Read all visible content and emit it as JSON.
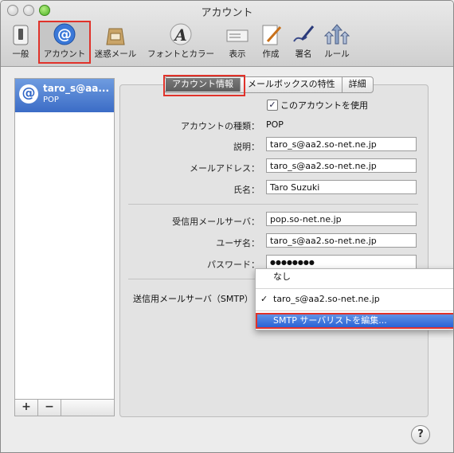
{
  "window": {
    "title": "アカウント"
  },
  "toolbar": {
    "items": [
      {
        "label": "一般",
        "icon": "switch-icon"
      },
      {
        "label": "アカウント",
        "icon": "at-sign-icon",
        "selected": true
      },
      {
        "label": "迷惑メール",
        "icon": "junk-mail-bag-icon"
      },
      {
        "label": "フォントとカラー",
        "icon": "font-color-icon"
      },
      {
        "label": "表示",
        "icon": "view-icon"
      },
      {
        "label": "作成",
        "icon": "compose-pen-icon"
      },
      {
        "label": "署名",
        "icon": "signature-pen-icon"
      },
      {
        "label": "ルール",
        "icon": "rules-arrows-icon"
      }
    ]
  },
  "sidebar": {
    "accounts": [
      {
        "name": "taro_s@aa...",
        "type": "POP"
      }
    ],
    "add_label": "+",
    "remove_label": "−"
  },
  "tabs": [
    {
      "label": "アカウント情報",
      "selected": true
    },
    {
      "label": "メールボックスの特性"
    },
    {
      "label": "詳細"
    }
  ],
  "form": {
    "enable_label": "このアカウントを使用",
    "enable_checked": true,
    "account_type_label": "アカウントの種類：",
    "account_type_value": "POP",
    "description_label": "説明：",
    "description_value": "taro_s@aa2.so-net.ne.jp",
    "email_label": "メールアドレス：",
    "email_value": "taro_s@aa2.so-net.ne.jp",
    "name_label": "氏名：",
    "name_value": "Taro Suzuki",
    "incoming_label": "受信用メールサーバ：",
    "incoming_value": "pop.so-net.ne.jp",
    "username_label": "ユーザ名：",
    "username_value": "taro_s@aa2.so-net.ne.jp",
    "password_label": "パスワード：",
    "password_value": "●●●●●●●●",
    "smtp_label": "送信用メールサーバ（SMTP）"
  },
  "smtp_menu": {
    "items": [
      {
        "label": "なし"
      },
      {
        "label": "taro_s@aa2.so-net.ne.jp",
        "checked": true
      },
      {
        "label": "SMTP サーバリストを編集...",
        "highlighted": true
      }
    ],
    "check_mark": "✓"
  },
  "help": {
    "label": "?"
  },
  "colors": {
    "highlight_box": "#e0322a",
    "selection_blue": "#3b6cc6"
  }
}
